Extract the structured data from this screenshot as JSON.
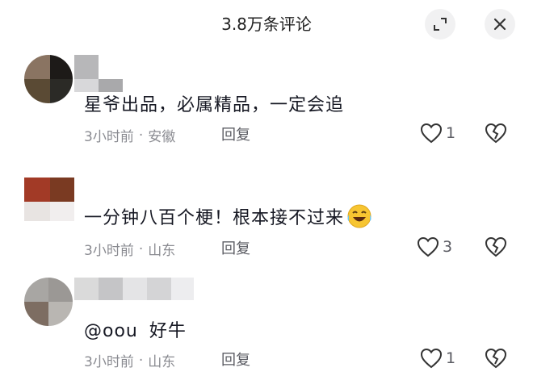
{
  "header": {
    "title": "3.8万条评论"
  },
  "comments": [
    {
      "text": "星爷出品，必属精品，一定会追",
      "time": "3小时前",
      "location": "安徽",
      "reply_label": "回复",
      "likes": "1"
    },
    {
      "text": "一分钟八百个梗！根本接不过来",
      "emoji": "laughing-crying-emoji",
      "time": "3小时前",
      "location": "山东",
      "reply_label": "回复",
      "likes": "3"
    },
    {
      "mention": "@oou",
      "text": "好牛",
      "time": "3小时前",
      "location": "山东",
      "reply_label": "回复",
      "likes": "1"
    }
  ],
  "separator": "·"
}
